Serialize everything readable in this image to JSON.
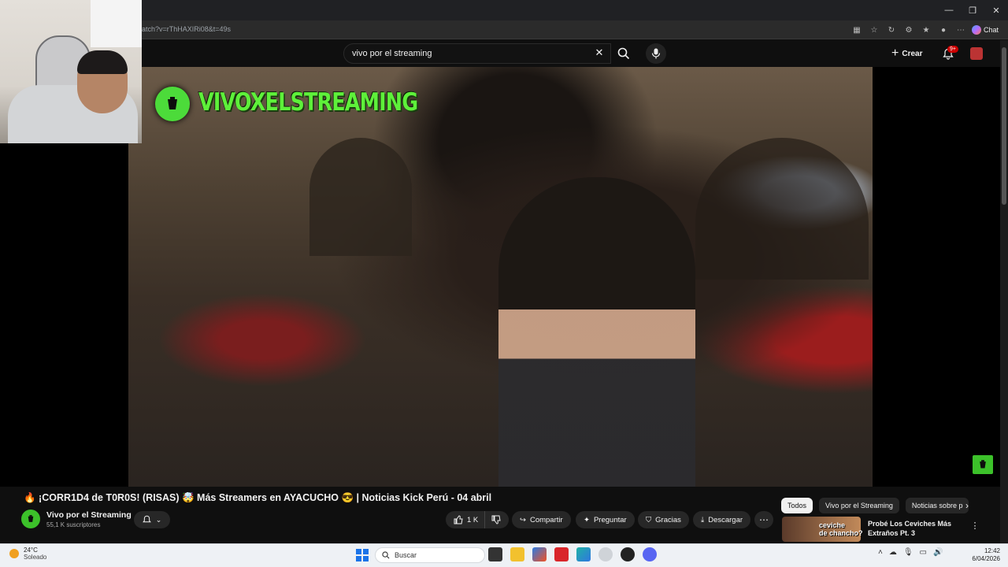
{
  "browser": {
    "url": "atch?v=rThHAXIRi08&t=49s",
    "chat_label": "Chat",
    "window_controls": [
      "—",
      "❐",
      "✕"
    ]
  },
  "youtube": {
    "search_query": "vivo por el streaming",
    "create_label": "Crear",
    "notification_count": "9+"
  },
  "player": {
    "logo_text": "VIVOXELSTREAMING"
  },
  "video": {
    "title": "🔥 ¡CORR1D4 de T0R0S! (RISAS) 🤯 Más Streamers en AYACUCHO 😎 | Noticias Kick Perú - 04 abril",
    "channel_name": "Vivo por el Streaming",
    "subscribers": "55,1 K suscriptores",
    "like_count": "1 K",
    "share_label": "Compartir",
    "ask_label": "Preguntar",
    "thanks_label": "Gracias",
    "download_label": "Descargar"
  },
  "sidebar": {
    "chips": [
      "Todos",
      "Vivo por el Streaming",
      "Noticias sobre p"
    ],
    "recommendation": {
      "thumb_text_line1": "ceviche",
      "thumb_text_line2": "de chancho?",
      "title": "Probé Los Ceviches Más Extraños Pt. 3"
    }
  },
  "taskbar": {
    "temperature": "24°C",
    "condition": "Soleado",
    "search_placeholder": "Buscar",
    "time": "12:42",
    "date": "6/04/2026"
  },
  "colors": {
    "brand_green": "#3cc12a",
    "yt_red": "#cc0000",
    "background": "#0f0f0f"
  }
}
